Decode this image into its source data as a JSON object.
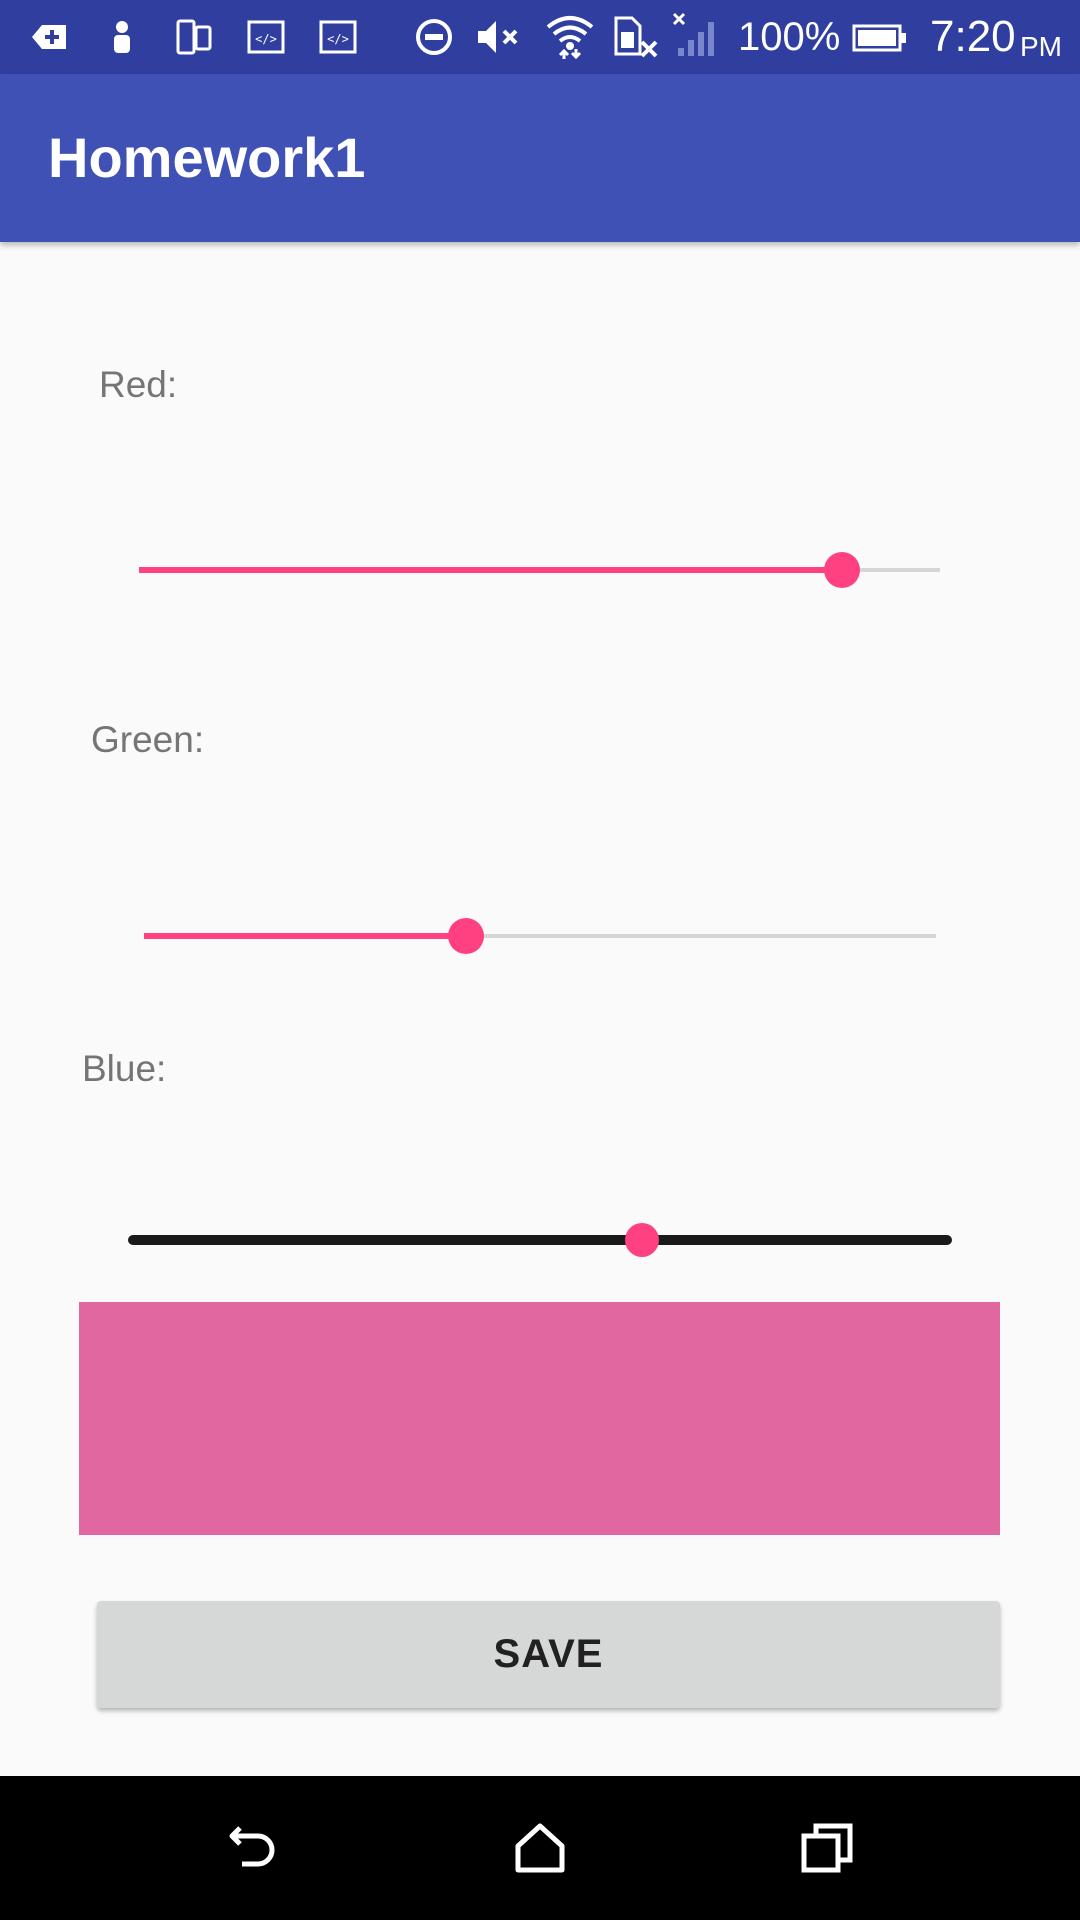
{
  "status_bar": {
    "battery_percent": "100%",
    "time": "7:20",
    "ampm": "PM",
    "icons": [
      "notification-add-icon",
      "person-icon",
      "device-icon",
      "code-icon",
      "code-icon",
      "do-not-disturb-icon",
      "volume-muted-icon",
      "wifi-icon",
      "sim-card-off-icon",
      "cell-signal-off-icon",
      "battery-icon"
    ]
  },
  "app_bar": {
    "title": "Homework1"
  },
  "sliders": {
    "red": {
      "label": "Red:",
      "value_fraction": 0.878
    },
    "green": {
      "label": "Green:",
      "value_fraction": 0.407
    },
    "blue": {
      "label": "Blue:",
      "value_fraction": 0.624
    }
  },
  "preview": {
    "color": "#e0679f"
  },
  "save_button": {
    "label": "SAVE"
  },
  "colors": {
    "status_bar": "#303f9f",
    "app_bar": "#3f51b5",
    "accent": "#ff4081",
    "button": "#d6d7d7"
  },
  "nav_bar": {
    "icons": [
      "back-icon",
      "home-icon",
      "recents-icon"
    ]
  }
}
